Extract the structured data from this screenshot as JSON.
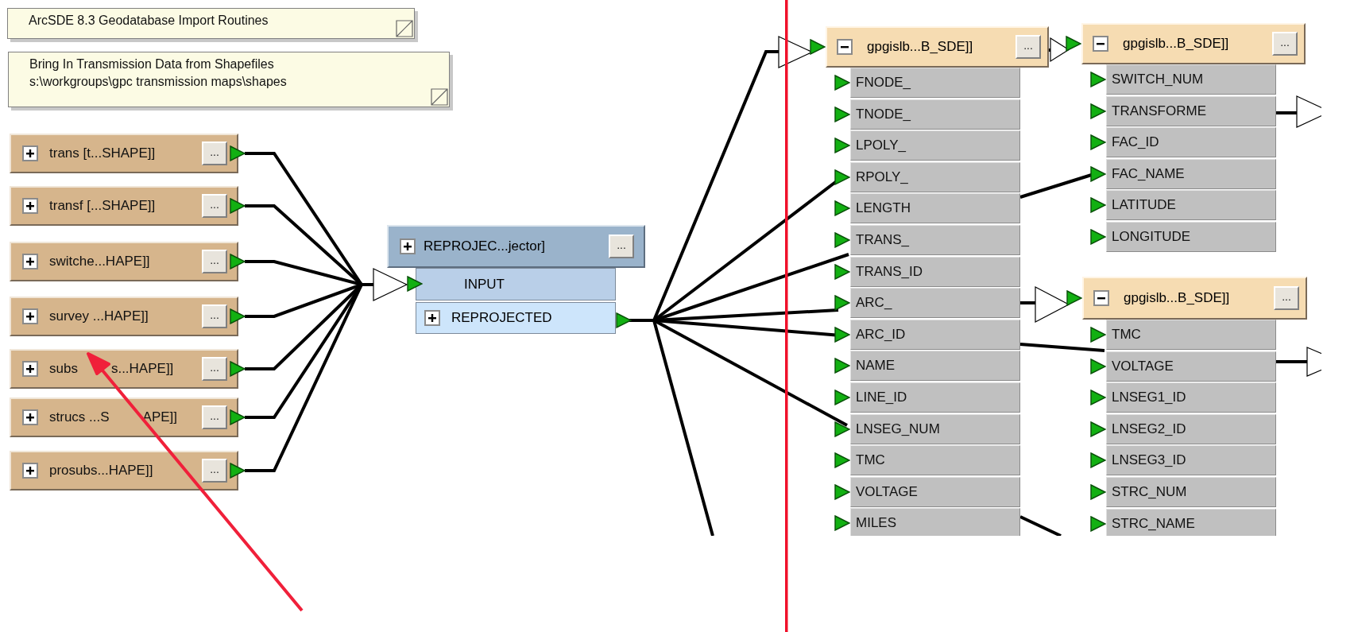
{
  "notes": [
    {
      "lines": [
        "ArcSDE 8.3 Geodatabase Import Routines"
      ]
    },
    {
      "lines": [
        "Bring In Transmission Data from Shapefiles",
        "s:\\workgroups\\gpc transmission maps\\shapes"
      ]
    }
  ],
  "readers": [
    {
      "label": "trans [t...SHAPE]]",
      "expanded": false,
      "button": "..."
    },
    {
      "label": "transf [...SHAPE]]",
      "expanded": false,
      "button": "..."
    },
    {
      "label": "switche...HAPE]]",
      "expanded": false,
      "button": "..."
    },
    {
      "label": "survey ...HAPE]]",
      "expanded": false,
      "button": "..."
    },
    {
      "label_parts": [
        "subs",
        "s...HAPE]]"
      ],
      "expanded": false,
      "button": "..."
    },
    {
      "label_parts": [
        "strucs ...S",
        "APE]]"
      ],
      "expanded": false,
      "button": "..."
    },
    {
      "label": "prosubs...HAPE]]",
      "expanded": false,
      "button": "..."
    }
  ],
  "transformer": {
    "label": "REPROJEC...jector]",
    "expanded": false,
    "button": "...",
    "ports": [
      {
        "kind": "input",
        "label": "INPUT"
      },
      {
        "kind": "output",
        "label": "REPROJECTED",
        "expanded": false
      }
    ]
  },
  "feature_types": [
    {
      "label": "gpgislb...B_SDE]]",
      "expanded": true,
      "button": "...",
      "attributes": [
        "FNODE_",
        "TNODE_",
        "LPOLY_",
        "RPOLY_",
        "LENGTH",
        "TRANS_",
        "TRANS_ID",
        "ARC_",
        "ARC_ID",
        "NAME",
        "LINE_ID",
        "LNSEG_NUM",
        "TMC",
        "VOLTAGE",
        "MILES"
      ]
    },
    {
      "label": "gpgislb...B_SDE]]",
      "expanded": true,
      "button": "...",
      "attributes": [
        "SWITCH_NUM",
        "TRANSFORME",
        "FAC_ID",
        "FAC_NAME",
        "LATITUDE",
        "LONGITUDE"
      ]
    },
    {
      "label": "gpgislb...B_SDE]]",
      "expanded": true,
      "button": "...",
      "attributes": [
        "TMC",
        "VOLTAGE",
        "LNSEG1_ID",
        "LNSEG2_ID",
        "LNSEG3_ID",
        "STRC_NUM",
        "STRC_NAME"
      ]
    }
  ]
}
